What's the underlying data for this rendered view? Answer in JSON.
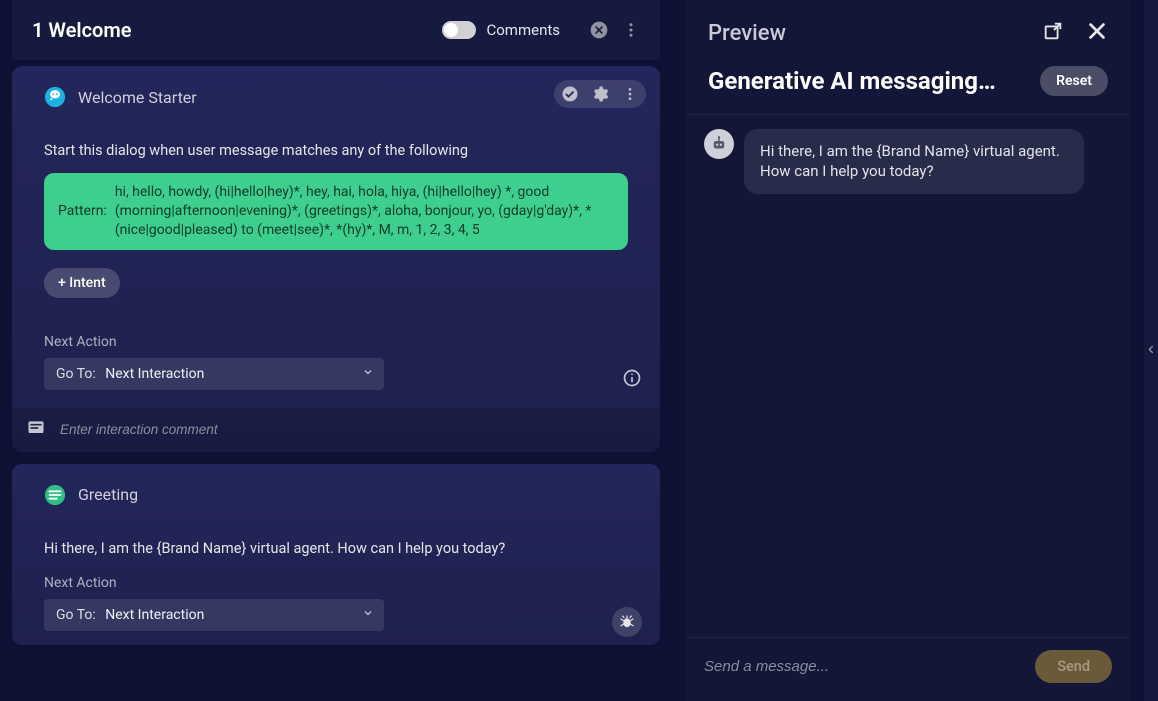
{
  "left": {
    "header": {
      "title": "1 Welcome",
      "comments_label": "Comments"
    },
    "cards": {
      "welcome_starter": {
        "title": "Welcome Starter",
        "instruction": "Start this dialog when user message matches any of the following",
        "pattern_label": "Pattern:",
        "pattern_value": "hi, hello, howdy, (hi|hello|hey)*, hey, hai, hola, hiya, (hi|hello|hey) *, good (morning|afternoon|evening)*, (greetings)*, aloha, bonjour, yo, (gday|g'day)*, *(nice|good|pleased) to (meet|see)*, *(hy)*, M, m, 1, 2, 3, 4, 5",
        "add_intent_label": "+ Intent",
        "next_action_label": "Next Action",
        "goto_prefix": "Go To:",
        "goto_value": "Next Interaction",
        "comment_placeholder": "Enter interaction comment"
      },
      "greeting": {
        "title": "Greeting",
        "text": "Hi there,  I am the {Brand Name} virtual agent. How can I help you today?",
        "next_action_label": "Next Action",
        "goto_prefix": "Go To:",
        "goto_value": "Next Interaction"
      }
    }
  },
  "preview": {
    "panel_title": "Preview",
    "subtitle": "Generative AI messaging…",
    "reset_label": "Reset",
    "bot_message": "Hi there, I am the {Brand Name} virtual agent. How can I help you today?",
    "composer_placeholder": "Send a message...",
    "send_label": "Send"
  },
  "colors": {
    "pattern_bg": "#3ecf8e"
  }
}
